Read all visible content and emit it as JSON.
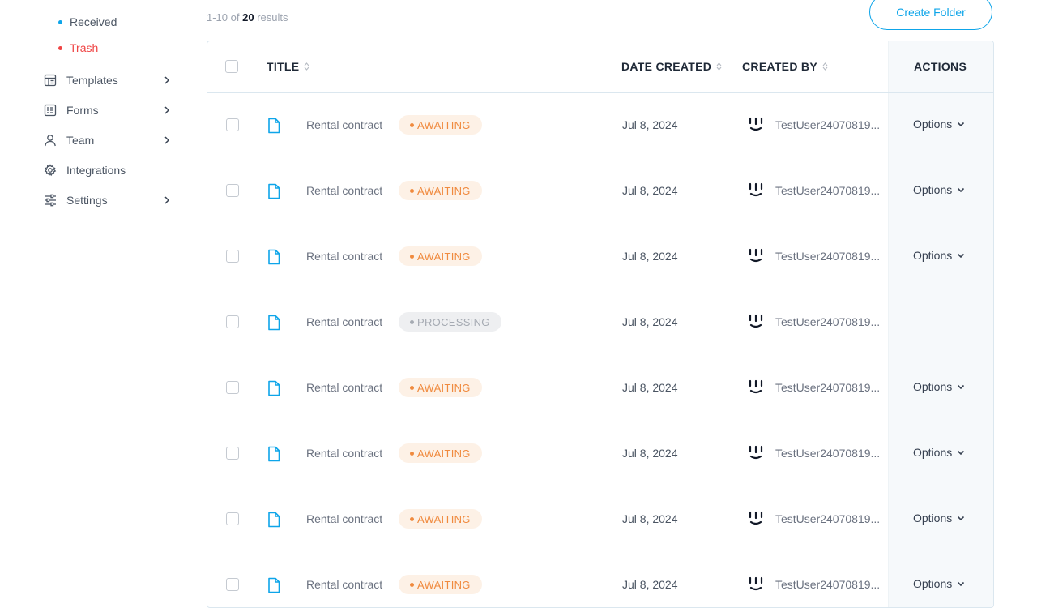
{
  "sidebar": {
    "sub_items": [
      {
        "label": "Received",
        "color": "#0ea5e9"
      },
      {
        "label": "Trash",
        "color": "#ef4444"
      }
    ],
    "items": [
      {
        "label": "Templates",
        "icon": "templates-icon",
        "has_chevron": true
      },
      {
        "label": "Forms",
        "icon": "forms-icon",
        "has_chevron": true
      },
      {
        "label": "Team",
        "icon": "user-icon",
        "has_chevron": true
      },
      {
        "label": "Integrations",
        "icon": "gear-icon",
        "has_chevron": false
      },
      {
        "label": "Settings",
        "icon": "sliders-icon",
        "has_chevron": true
      }
    ]
  },
  "toolbar": {
    "results_range": "1-10 of",
    "results_total": "20",
    "results_suffix": "results",
    "create_folder_label": "Create Folder"
  },
  "table": {
    "columns": {
      "title": "TITLE",
      "date_created": "DATE CREATED",
      "created_by": "CREATED BY",
      "actions": "ACTIONS"
    },
    "rows": [
      {
        "title": "Rental contract",
        "status": "AWAITING",
        "date": "Jul 8, 2024",
        "user": "TestUser24070819...",
        "action": "Options"
      },
      {
        "title": "Rental contract",
        "status": "AWAITING",
        "date": "Jul 8, 2024",
        "user": "TestUser24070819...",
        "action": "Options"
      },
      {
        "title": "Rental contract",
        "status": "AWAITING",
        "date": "Jul 8, 2024",
        "user": "TestUser24070819...",
        "action": "Options"
      },
      {
        "title": "Rental contract",
        "status": "PROCESSING",
        "date": "Jul 8, 2024",
        "user": "TestUser24070819...",
        "action": ""
      },
      {
        "title": "Rental contract",
        "status": "AWAITING",
        "date": "Jul 8, 2024",
        "user": "TestUser24070819...",
        "action": "Options"
      },
      {
        "title": "Rental contract",
        "status": "AWAITING",
        "date": "Jul 8, 2024",
        "user": "TestUser24070819...",
        "action": "Options"
      },
      {
        "title": "Rental contract",
        "status": "AWAITING",
        "date": "Jul 8, 2024",
        "user": "TestUser24070819...",
        "action": "Options"
      },
      {
        "title": "Rental contract",
        "status": "AWAITING",
        "date": "Jul 8, 2024",
        "user": "TestUser24070819...",
        "action": "Options"
      }
    ]
  },
  "colors": {
    "accent": "#0ea5e9",
    "awaiting": "#f08a3e",
    "processing": "#a5aab2",
    "trash": "#ef4444"
  }
}
